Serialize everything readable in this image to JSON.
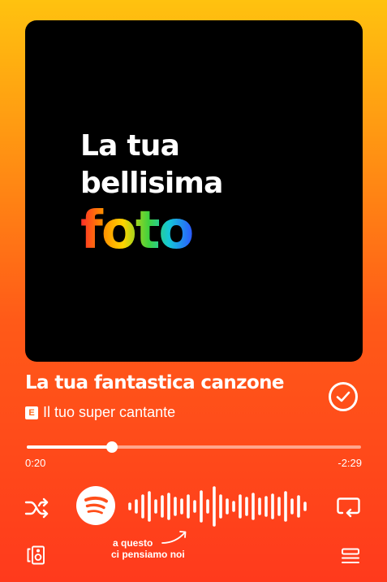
{
  "artwork": {
    "line1": "La tua",
    "line2": "bellisima",
    "line3": "foto"
  },
  "track": {
    "title": "La tua fantastica canzone",
    "explicit_badge": "E",
    "artist": "Il tuo super cantante",
    "liked": true
  },
  "progress": {
    "elapsed": "0:20",
    "remaining": "-2:29",
    "fraction": 0.255
  },
  "annotation": {
    "line1": "a questo",
    "line2": "ci pensiamo noi"
  },
  "icons": {
    "shuffle": "shuffle-icon",
    "logo": "spotify-logo-icon",
    "repeat": "repeat-icon",
    "device": "connect-device-icon",
    "queue": "queue-icon",
    "liked": "check-circle-icon"
  },
  "colors": {
    "gradient_top": "#ffc20f",
    "gradient_bottom": "#ff3a1c",
    "artwork_bg": "#000000"
  }
}
